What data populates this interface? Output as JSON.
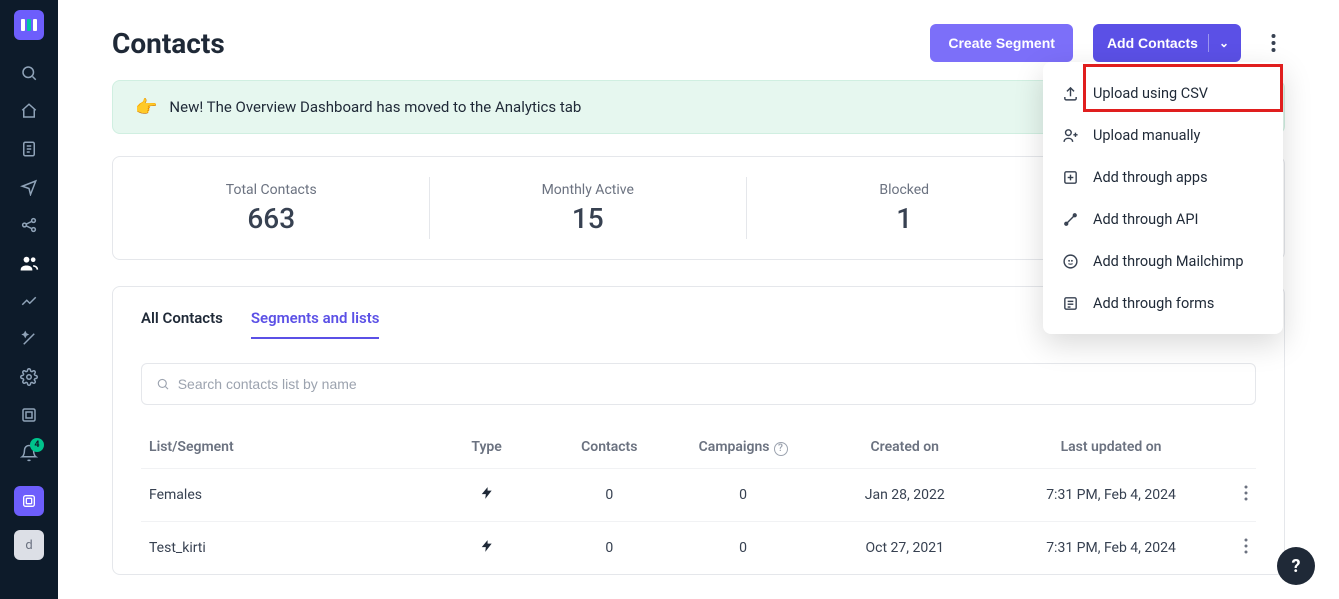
{
  "page": {
    "title": "Contacts"
  },
  "buttons": {
    "create_segment": "Create Segment",
    "add_contacts": "Add Contacts"
  },
  "banner": {
    "text": "New! The Overview Dashboard has moved to the Analytics tab"
  },
  "stats": [
    {
      "label": "Total Contacts",
      "value": "663"
    },
    {
      "label": "Monthly Active",
      "value": "15"
    },
    {
      "label": "Blocked",
      "value": "1"
    }
  ],
  "tabs": {
    "all": "All Contacts",
    "segments": "Segments and lists"
  },
  "search": {
    "placeholder": "Search contacts list by name"
  },
  "table": {
    "headers": {
      "list": "List/Segment",
      "type": "Type",
      "contacts": "Contacts",
      "campaigns": "Campaigns",
      "created": "Created on",
      "updated": "Last updated on"
    },
    "rows": [
      {
        "name": "Females",
        "contacts": "0",
        "campaigns": "0",
        "created": "Jan 28, 2022",
        "updated": "7:31 PM, Feb 4, 2024"
      },
      {
        "name": "Test_kirti",
        "contacts": "0",
        "campaigns": "0",
        "created": "Oct 27, 2021",
        "updated": "7:31 PM, Feb 4, 2024"
      }
    ]
  },
  "dropdown": {
    "items": [
      "Upload using CSV",
      "Upload manually",
      "Add through apps",
      "Add through API",
      "Add through Mailchimp",
      "Add through forms"
    ]
  },
  "sidebar": {
    "badge": "4",
    "avatar": "d"
  },
  "help": "?"
}
